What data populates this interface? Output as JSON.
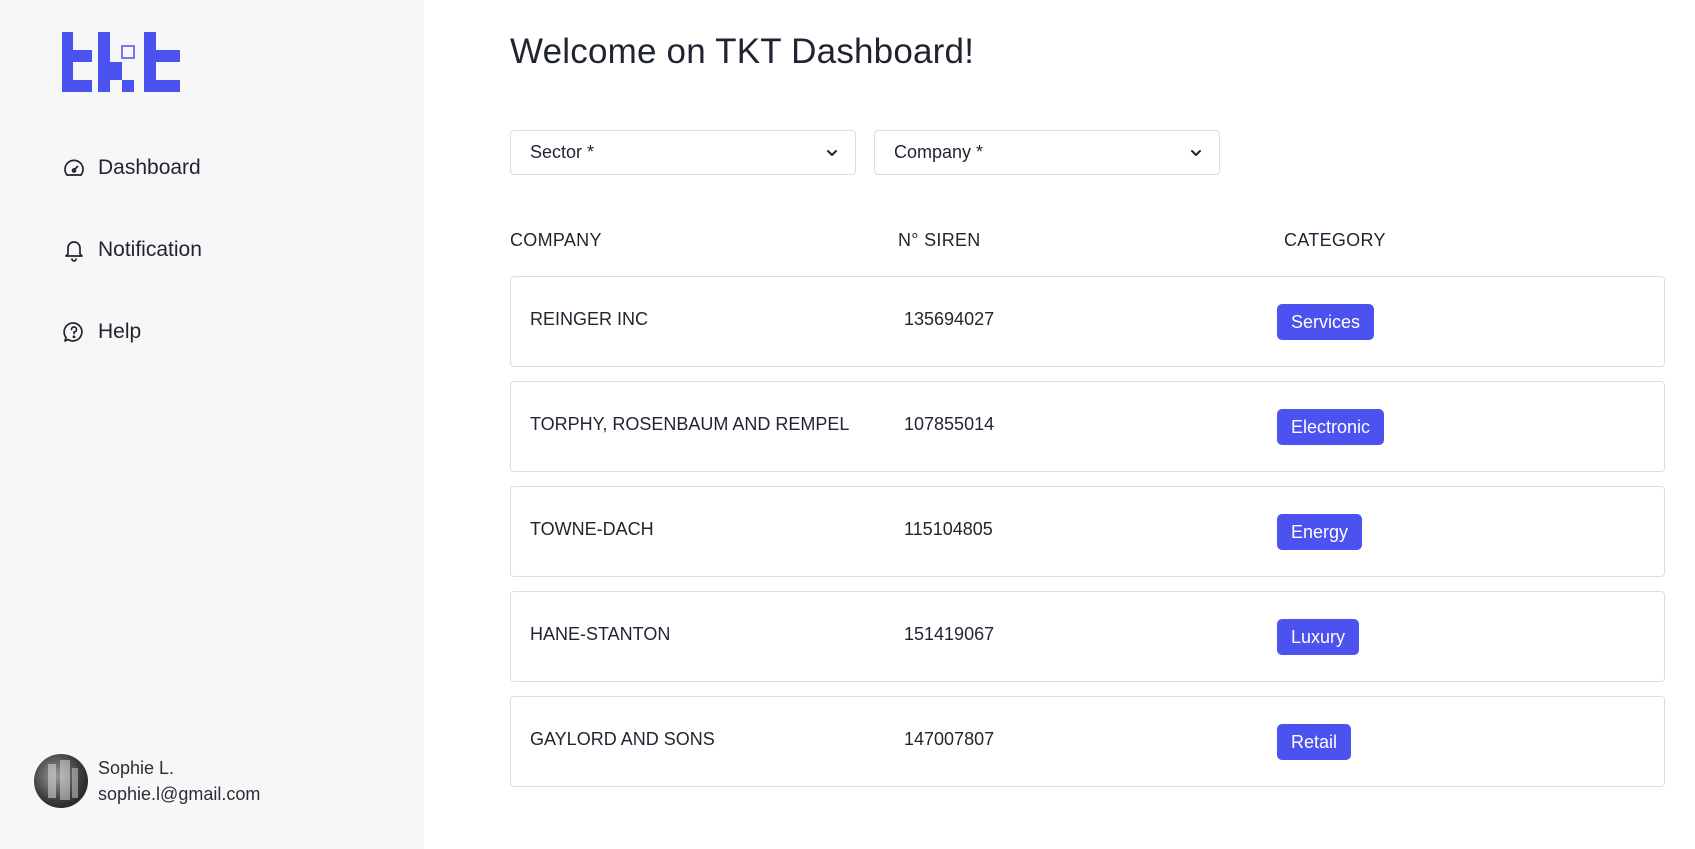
{
  "app": {
    "title": "Welcome on TKT Dashboard!"
  },
  "colors": {
    "accent": "#4c52f0",
    "sidebar_bg": "#f7f7f8",
    "border": "#dcdde1"
  },
  "sidebar": {
    "items": [
      {
        "label": "Dashboard",
        "icon": "gauge-icon"
      },
      {
        "label": "Notification",
        "icon": "bell-icon"
      },
      {
        "label": "Help",
        "icon": "help-bubble-icon"
      }
    ],
    "user": {
      "name": "Sophie L.",
      "email": "sophie.l@gmail.com"
    }
  },
  "filters": {
    "sector_label": "Sector *",
    "company_label": "Company *"
  },
  "table": {
    "headers": [
      "COMPANY",
      "N° SIREN",
      "CATEGORY"
    ],
    "rows": [
      {
        "company": "REINGER INC",
        "siren": "135694027",
        "category": "Services"
      },
      {
        "company": "TORPHY, ROSENBAUM AND REMPEL",
        "siren": "107855014",
        "category": "Electronic"
      },
      {
        "company": "TOWNE-DACH",
        "siren": "115104805",
        "category": "Energy"
      },
      {
        "company": "HANE-STANTON",
        "siren": "151419067",
        "category": "Luxury"
      },
      {
        "company": "GAYLORD AND SONS",
        "siren": "147007807",
        "category": "Retail"
      }
    ]
  }
}
